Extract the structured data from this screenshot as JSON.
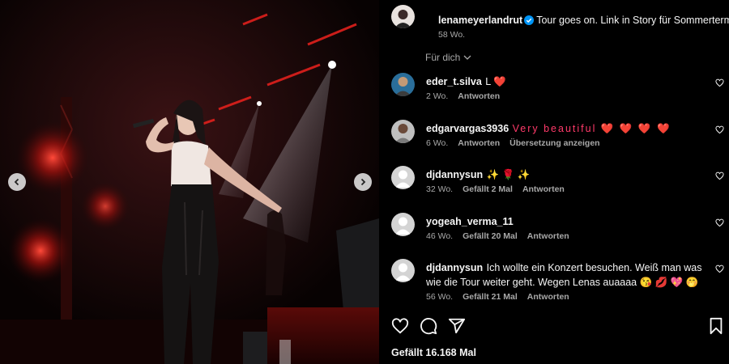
{
  "post": {
    "author": "lenameyerlandrut",
    "caption": "Tour goes on. Link in Story für Sommertermine",
    "time": "58 Wo.",
    "for_you": "Für dich"
  },
  "comments": [
    {
      "user": "eder_t.silva",
      "text": "L ❤️",
      "time": "2 Wo.",
      "likes": "",
      "reply": "Antworten",
      "translate": ""
    },
    {
      "user": "edgarvargas3936",
      "text": "Very beautiful ❤️ ❤️ ❤️ ❤️",
      "time": "6 Wo.",
      "likes": "",
      "reply": "Antworten",
      "translate": "Übersetzung anzeigen"
    },
    {
      "user": "djdannysun",
      "text": "✨ 🌹 ✨",
      "time": "32 Wo.",
      "likes": "Gefällt 2 Mal",
      "reply": "Antworten",
      "translate": ""
    },
    {
      "user": "yogeah_verma_11",
      "text": "",
      "time": "46 Wo.",
      "likes": "Gefällt 20 Mal",
      "reply": "Antworten",
      "translate": ""
    },
    {
      "user": "djdannysun",
      "text": "Ich wollte ein Konzert besuchen. Weiß man was wie die Tour weiter geht. Wegen Lenas auaaaa 😘 💋 💖 🤭",
      "time": "56 Wo.",
      "likes": "Gefällt 21 Mal",
      "reply": "Antworten",
      "translate": ""
    }
  ],
  "footer": {
    "likes": "Gefällt 16.168 Mal"
  },
  "icons": {
    "verified": "verified-badge-icon",
    "like": "heart-icon",
    "comment": "comment-icon",
    "share": "share-icon",
    "save": "bookmark-icon",
    "prev": "chevron-left-icon",
    "next": "chevron-right-icon"
  },
  "colors": {
    "background": "#000000",
    "verified": "#0095f6",
    "secondary_text": "#a8a8a8",
    "stage_red": "#e0201c"
  }
}
